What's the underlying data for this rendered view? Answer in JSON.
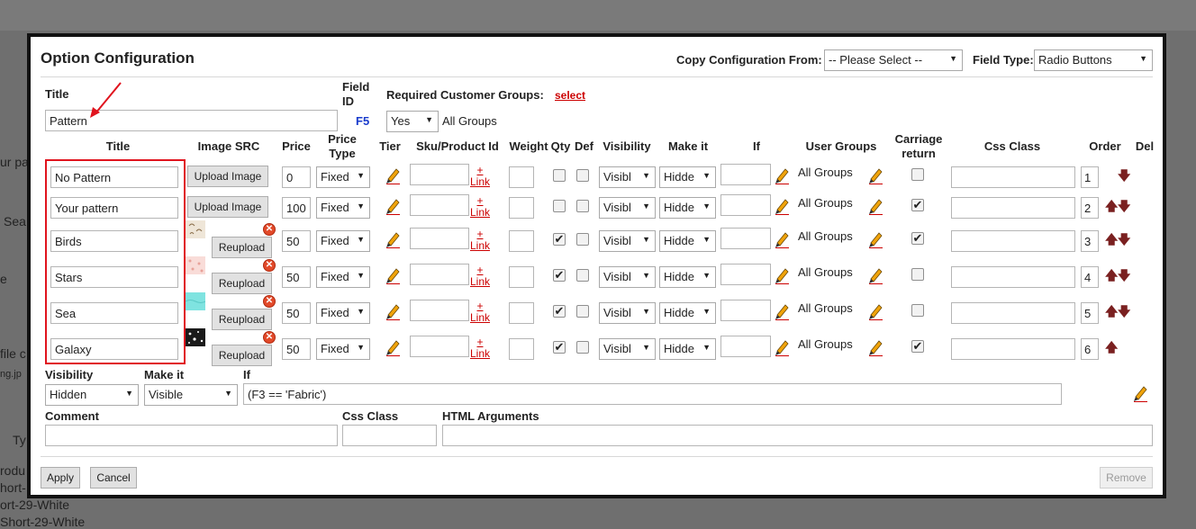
{
  "background": {
    "fragments": [
      "ur pa",
      "Sea",
      "e",
      "file c",
      "ng.jp",
      "Ty",
      "rodu",
      "hort-",
      "ort-29-White",
      "Short-29-White"
    ]
  },
  "dialog": {
    "title": "Option Configuration",
    "copy_label": "Copy Configuration From:",
    "copy_value": "-- Please Select --",
    "field_type_label": "Field Type:",
    "field_type_value": "Radio Buttons",
    "title_label": "Title",
    "title_value": "Pattern",
    "field_id_label": "Field ID",
    "field_id_value": "F5",
    "groups_label": "Required Customer Groups:",
    "groups_select_link": "select",
    "groups_required_value": "Yes",
    "groups_value": "All Groups"
  },
  "columns": {
    "title": "Title",
    "image_src": "Image SRC",
    "price": "Price",
    "price_type": "Price Type",
    "tier": "Tier",
    "sku": "Sku/Product Id",
    "weight": "Weight",
    "qty": "Qty",
    "def": "Def",
    "visibility": "Visibility",
    "make_it": "Make it",
    "if": "If",
    "user_groups": "User Groups",
    "carriage": "Carriage return",
    "css_class": "Css Class",
    "order": "Order",
    "del": "Del"
  },
  "rows": [
    {
      "title": "No Pattern",
      "image_btn": "Upload Image",
      "price": "0",
      "price_type": "Fixed",
      "link": "+ Link",
      "visibility": "Visibl",
      "make_it": "Hidde",
      "groups": "All Groups",
      "order": "1",
      "qty": false,
      "def": false,
      "carriage": false
    },
    {
      "title": "Your pattern",
      "image_btn": "Upload Image",
      "price": "100",
      "price_type": "Fixed",
      "link": "+ Link",
      "visibility": "Visibl",
      "make_it": "Hidde",
      "groups": "All Groups",
      "order": "2",
      "qty": false,
      "def": false,
      "carriage": true
    },
    {
      "title": "Birds",
      "image_btn": "Reupload",
      "price": "50",
      "price_type": "Fixed",
      "link": "+ Link",
      "visibility": "Visibl",
      "make_it": "Hidde",
      "groups": "All Groups",
      "order": "3",
      "qty": true,
      "def": false,
      "carriage": true
    },
    {
      "title": "Stars",
      "image_btn": "Reupload",
      "price": "50",
      "price_type": "Fixed",
      "link": "+ Link",
      "visibility": "Visibl",
      "make_it": "Hidde",
      "groups": "All Groups",
      "order": "4",
      "qty": true,
      "def": false,
      "carriage": false
    },
    {
      "title": "Sea",
      "image_btn": "Reupload",
      "price": "50",
      "price_type": "Fixed",
      "link": "+ Link",
      "visibility": "Visibl",
      "make_it": "Hidde",
      "groups": "All Groups",
      "order": "5",
      "qty": true,
      "def": false,
      "carriage": false
    },
    {
      "title": "Galaxy",
      "image_btn": "Reupload",
      "price": "50",
      "price_type": "Fixed",
      "link": "+ Link",
      "visibility": "Visibl",
      "make_it": "Hidde",
      "groups": "All Groups",
      "order": "6",
      "qty": true,
      "def": false,
      "carriage": true
    }
  ],
  "bottom": {
    "visibility_label": "Visibility",
    "visibility_value": "Hidden",
    "make_it_label": "Make it",
    "make_it_value": "Visible",
    "if_label": "If",
    "if_value": "(F3 == 'Fabric')",
    "comment_label": "Comment",
    "css_label": "Css Class",
    "html_args_label": "HTML Arguments"
  },
  "footer": {
    "apply": "Apply",
    "cancel": "Cancel",
    "remove": "Remove"
  },
  "colors": {
    "highlight": "#e0141e",
    "link": "#cc0000",
    "field_id": "#1a3ccc",
    "arrow": "#7a2020"
  }
}
